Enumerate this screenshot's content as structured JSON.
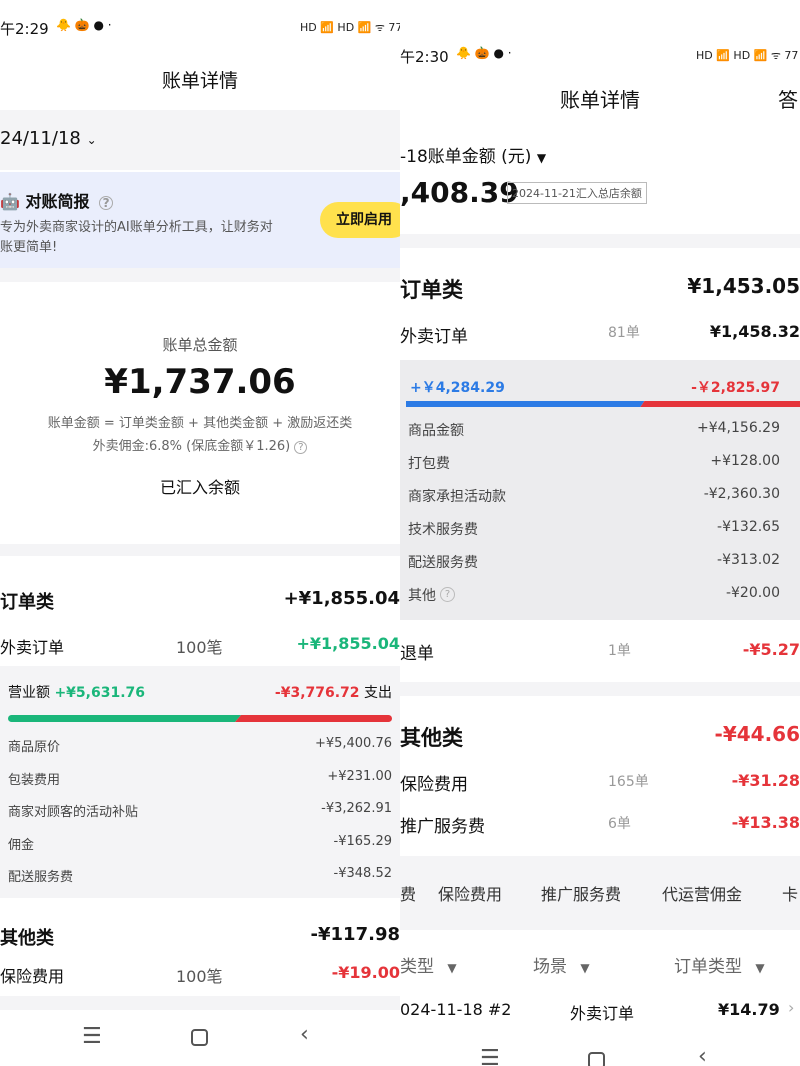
{
  "left": {
    "status_time": "午2:29",
    "status_extra": "🐥 🎃 ● ·",
    "status_right": "HD 📶 HD 📶 ᯤ 77",
    "title": "账单详情",
    "date": "24/11/18",
    "report_title": "对账简报",
    "report_desc_1": "专为外卖商家设计的AI账单分析工具，让财务对",
    "report_desc_2": "账更简单!",
    "enable_button": "立即启用",
    "total_label": "账单总金额",
    "total_amount": "¥1,737.06",
    "formula": "账单金额 = 订单类金额 + 其他类金额 + 激励返还类",
    "commission": "外卖佣金:6.8% (保底金额￥1.26)",
    "settled": "已汇入余额",
    "order_cat_label": "订单类",
    "order_cat_amount": "+¥1,855.04",
    "takeout_label": "外卖订单",
    "takeout_count": "100笔",
    "takeout_amount": "+¥1,855.04",
    "revenue_label": "营业额",
    "revenue_amount": "+¥5,631.76",
    "expense_amount": "-¥3,776.72",
    "expense_label": "支出",
    "bar_green_fraction": 0.599,
    "details": [
      {
        "label": "商品原价",
        "value": "+¥5,400.76"
      },
      {
        "label": "包装费用",
        "value": "+¥231.00"
      },
      {
        "label": "商家对顾客的活动补贴",
        "value": "-¥3,262.91"
      },
      {
        "label": "佣金",
        "value": "-¥165.29"
      },
      {
        "label": "配送服务费",
        "value": "-¥348.52"
      }
    ],
    "other_cat_label": "其他类",
    "other_cat_amount": "-¥117.98",
    "insurance_label": "保险费用",
    "insurance_count": "100笔",
    "insurance_amount": "-¥19.00"
  },
  "right": {
    "status_time": "午2:30",
    "status_extra": "🐥 🎃 ● ·",
    "status_right": "HD 📶 HD 📶 ᯤ 77",
    "title": "账单详情",
    "answer_partial": "答",
    "amount_header": "-18账单金额 (元)",
    "amount": ",408.39",
    "amount_badge": "2024-11-21汇入总店余额",
    "order_cat_label": "订单类",
    "order_cat_amount": "¥1,453.05",
    "takeout_label": "外卖订单",
    "takeout_count": "81单",
    "takeout_amount": "¥1,458.32",
    "income_amount": "+￥4,284.29",
    "expense_amount": "-￥2,825.97",
    "bar_blue_fraction": 0.6,
    "details": [
      {
        "label": "商品金额",
        "value": "+¥4,156.29"
      },
      {
        "label": "打包费",
        "value": "+¥128.00"
      },
      {
        "label": "商家承担活动款",
        "value": "-¥2,360.30"
      },
      {
        "label": "技术服务费",
        "value": "-¥132.65"
      },
      {
        "label": "配送服务费",
        "value": "-¥313.02"
      },
      {
        "label": "其他",
        "value": "-¥20.00"
      }
    ],
    "refund_label": "退单",
    "refund_count": "1单",
    "refund_amount": "-¥5.27",
    "other_cat_label": "其他类",
    "other_cat_amount": "-¥44.66",
    "insurance_label": "保险费用",
    "insurance_count": "165单",
    "insurance_amount": "-¥31.28",
    "promo_label": "推广服务费",
    "promo_count": "6单",
    "promo_amount": "-¥13.38",
    "tabs": [
      "费",
      "保险费用",
      "推广服务费",
      "代运营佣金",
      "卡"
    ],
    "filters": [
      "类型",
      "场景",
      "订单类型"
    ],
    "list_date": "024-11-18 #2",
    "list_type": "外卖订单",
    "list_amount": "¥14.79"
  },
  "colors": {
    "green": "#1ab67a",
    "red": "#e5343a",
    "blue": "#2c7be5",
    "yellow": "#ffe14d"
  }
}
